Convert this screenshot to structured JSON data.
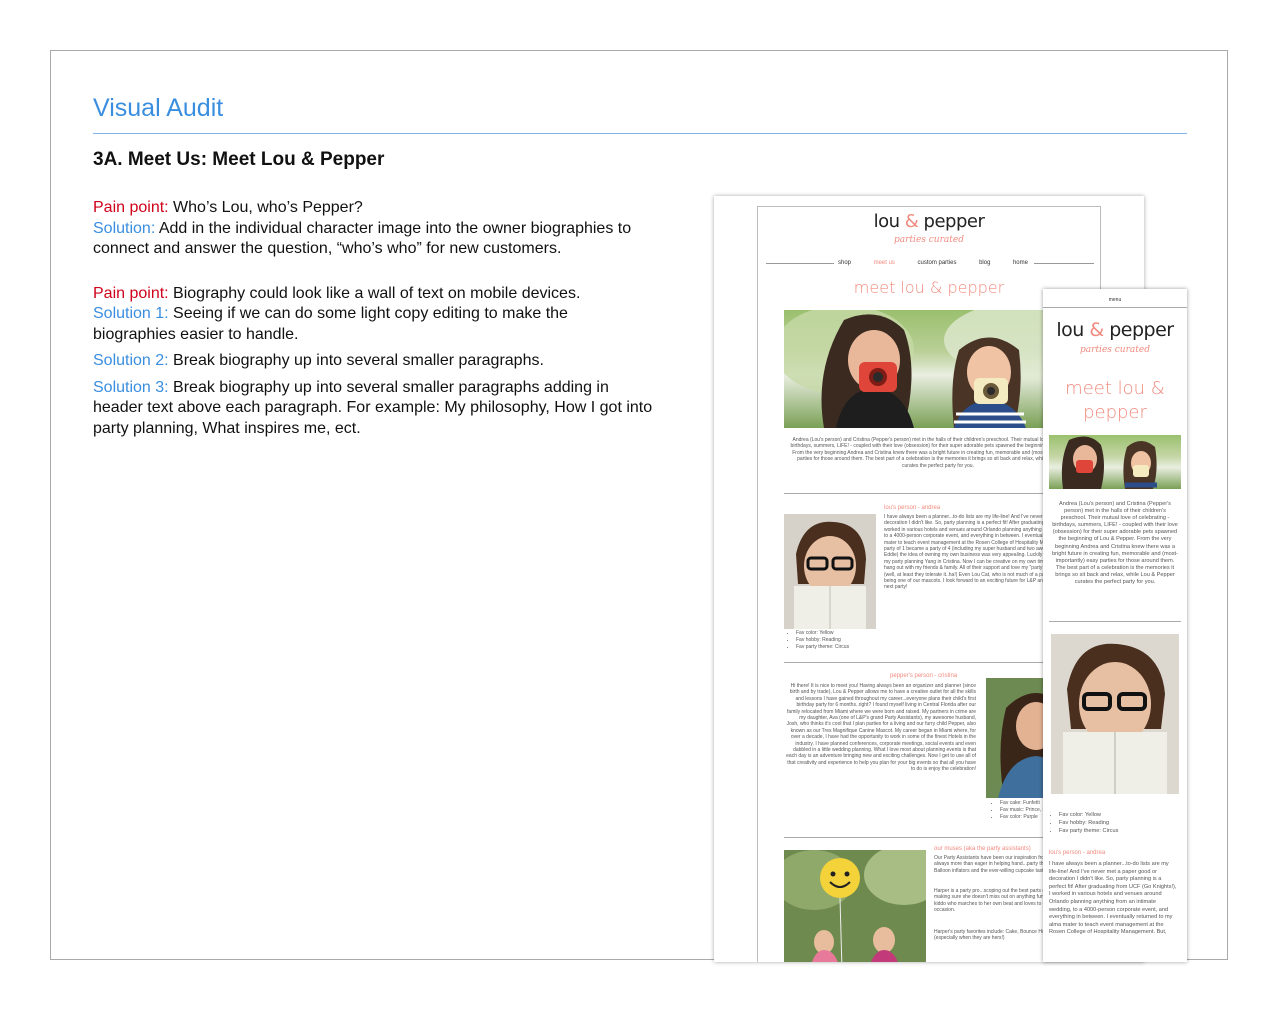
{
  "slide": {
    "title": "Visual Audit",
    "section": "3A. Meet Us: Meet Lou & Pepper"
  },
  "notes": {
    "pp1_label": "Pain point:",
    "pp1_text": " Who’s Lou, who’s Pepper?",
    "sol1_label": "Solution:",
    "sol1_text": " Add in the individual character image into the owner biographies to connect and answer the question, “who’s who” for new customers.",
    "pp2_label": "Pain point:",
    "pp2_text": " Biography could look like a wall of text on mobile devices.",
    "s1_label": "Solution 1:",
    "s1_text": " Seeing if we can do some light copy editing to make the biographies easier to handle.",
    "s2_label": "Solution 2:",
    "s2_text": " Break biography up into several smaller paragraphs.",
    "s3_label": "Solution 3:",
    "s3_text": " Break biography up into several smaller paragraphs adding in header text above each paragraph. For example: My philosophy, How I got into party planning, What inspires me, ect."
  },
  "site": {
    "logo_left": "lou ",
    "logo_amp": "&",
    "logo_right": " pepper",
    "tagline": "parties curated",
    "nav": [
      "shop",
      "meet us",
      "custom parties",
      "blog",
      "home"
    ],
    "heading": "meet lou & pepper",
    "intro": "Andrea (Lou's person) and Cristina (Pepper's person) met in the halls of their children's preschool. Their mutual love of celebrating - birthdays, summers, LIFE! - coupled with their love (obsession) for their super adorable pets spawned the beginning of Lou & Pepper. From the very beginning Andrea and Cristina knew there was a bright future in creating fun, memorable and (most-importantly) easy parties for those around them. The best part of a celebration is the memories it brings so sit back and relax, while Lou & Pepper curates the perfect party for you.",
    "lou_head": "lou's person - andrea",
    "lou_bio": "I have always been a planner...to-do lists are my life-line! And I've never met a paper good or decoration I didn't like. So, party planning is a perfect fit! After graduating from UCF (Go Knights!), I worked in various hotels and venues around Orlando planning anything from an intimate wedding, to a 4000-person corporate event, and everything in between. I eventually returned to my alma mater to teach event management at the Rosen College of Hospitality Management. But, once my party of 1 became a party of 4 (including my super husband and two awesome kids, Harper and Eddie) the idea of owning my own business was very appealing. Luckily I found the perfect Yin to my party planning Yang in Cristina. Now I can be creative on my own time and still have time to hang out with my friends & family. All of their support and love my \"party for every occasion\" attitude (well, at least they tolerate it..ha!) Even Lou Cat, who is not much of a party animal, is involved by being one of our mascots. I look forward to an exciting future for L&P and can't wait to curate your next party!",
    "lou_favs": [
      "Fav color: Yellow",
      "Fav hobby: Reading",
      "Fav party theme: Circus"
    ],
    "pepper_head": "pepper's person - cristina",
    "pepper_bio": "Hi there! It is nice to meet you! Having always been an organizer and planner (since birth and by trade), Lou & Pepper allows me to have a creative outlet for all the skills and lessons I have gained throughout my career...everyone plans their child's first birthday party for 6 months..right? I found myself living in Central Florida after our family relocated from Miami where we were born and raised. My partners in crime are my daughter, Ava (one of L&P's grand Party Assistants), my awesome husband, Josh, who thinks it's cool that I plan parties for a living and our furry child Pepper, also known as our Tres Magnifique Canine Mascot. My career began in Miami where, for over a decade, I have had the opportunity to work in some of the finest Hotels in the industry. I have planned conferences, corporate meetings, social events and even dabbled in a little wedding planning. What I love most about planning events is that each day is an adventure bringing new and exciting challenges. Now I get to use all of that creativity and experience to help you plan for your big events so that all you have to do is enjoy the celebration!",
    "pepper_favs": [
      "Fav cake: Funfetti",
      "Fav music: Prince, R&B",
      "Fav color: Purple"
    ],
    "muses_head": "our muses (aka the party assistants)",
    "muses_bio1": "Our Party Assistants have been our inspiration from day one and are always more than eager in helping hand...party theme guinea pigs. Balloon inflators and the ever-willing cupcake tasters.",
    "muses_bio2": "Harper is a party pro...scoping out the best parts of the party and making sure she doesn't miss out on anything fun. She is a unique kiddo who marches to her own beat and loves to dress up for any occasion.",
    "muses_bio3": "Harper's party favorites include: Cake, Bounce Houses and Presents (especially when they are hers!)"
  },
  "mobile": {
    "menu": "menu",
    "heading": "meet lou & pepper",
    "intro": "Andrea (Lou's person) and Cristina (Pepper's person) met in the halls of their children's preschool. Their mutual love of celebrating - birthdays, summers, LIFE! - coupled with their love (obsession) for their super adorable pets spawned the beginning of Lou & Pepper. From the very beginning Andrea and Cristina knew there was a bright future in creating fun, memorable and (most-importantly) easy parties for those around them. The best part of a celebration is the memories it brings so sit back and relax, while Lou & Pepper curates the perfect party for you.",
    "favs": [
      "Fav color: Yellow",
      "Fav hobby: Reading",
      "Fav party theme: Circus"
    ],
    "lou_head": "lou's person - andrea",
    "lou_bio": "I have always been a planner...to-do lists are my life-line! And I've never met a paper good or decoration I didn't like. So, party planning is a perfect fit! After graduating from UCF (Go Knights!), I worked in various hotels and venues around Orlando planning anything from an intimate wedding, to a 4000-person corporate event, and everything in between. I eventually returned to my alma mater to teach event management at the Rosen College of Hospitality Management. But,"
  },
  "colors": {
    "accent_blue": "#3a8ee0",
    "pain_red": "#d0021b",
    "brand_coral": "#f18a7e"
  }
}
